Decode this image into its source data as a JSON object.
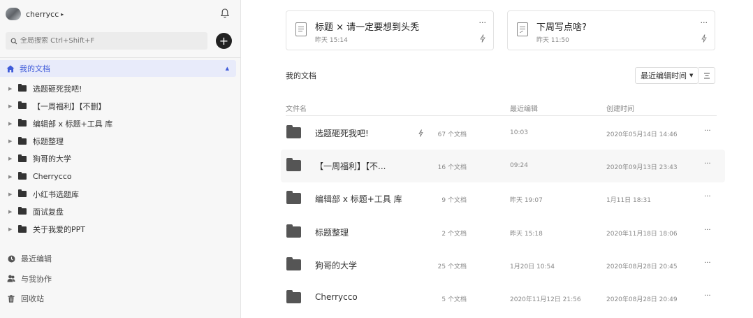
{
  "user": {
    "name": "cherrycc",
    "caret": "▸"
  },
  "search": {
    "placeholder": "全局搜索 Ctrl+Shift+F"
  },
  "add_label": "+",
  "my_docs": {
    "label": "我的文档",
    "caret": "▲"
  },
  "tree": {
    "arrow": "▶",
    "items": [
      {
        "label": "选题砸死我吧!"
      },
      {
        "label": "【一周福利】【不删】"
      },
      {
        "label": "编辑部 x 标题+工具 库"
      },
      {
        "label": "标题整理"
      },
      {
        "label": "狗哥的大学"
      },
      {
        "label": "Cherrycco"
      },
      {
        "label": "小红书选题库"
      },
      {
        "label": "面试复盘"
      },
      {
        "label": "关于我爱的PPT"
      }
    ]
  },
  "bottom_nav": [
    {
      "label": "最近编辑",
      "icon": "clock-icon"
    },
    {
      "label": "与我协作",
      "icon": "people-icon"
    },
    {
      "label": "回收站",
      "icon": "trash-icon"
    }
  ],
  "recent_cards": [
    {
      "title": "标题 × 请一定要想到头秃",
      "time": "昨天 15:14",
      "more": "···"
    },
    {
      "title": "下周写点啥?",
      "time": "昨天 11:50",
      "more": "···"
    }
  ],
  "section_title": "我的文档",
  "sort": {
    "label": "最近编辑时间",
    "caret": "▼"
  },
  "table": {
    "headers": {
      "name": "文件名",
      "edited": "最近编辑",
      "created": "创建时间"
    },
    "rows": [
      {
        "name": "选题砸死我吧!",
        "count": "67 个文档",
        "edited": "10:03",
        "created": "2020年05月14日 14:46",
        "bolt": true
      },
      {
        "name": "【一周福利】【不...",
        "count": "16 个文档",
        "edited": "09:24",
        "created": "2020年09月13日 23:43",
        "bolt": false
      },
      {
        "name": "编辑部 x 标题+工具 库",
        "count": "9 个文档",
        "edited": "昨天 19:07",
        "created": "1月11日 18:31",
        "bolt": false
      },
      {
        "name": "标题整理",
        "count": "2 个文档",
        "edited": "昨天 15:18",
        "created": "2020年11月18日 18:06",
        "bolt": false
      },
      {
        "name": "狗哥的大学",
        "count": "25 个文档",
        "edited": "1月20日 10:54",
        "created": "2020年08月28日 20:45",
        "bolt": false
      },
      {
        "name": "Cherrycco",
        "count": "5 个文档",
        "edited": "2020年11月12日 21:56",
        "created": "2020年08月28日 20:49",
        "bolt": false
      }
    ],
    "more": "···"
  },
  "colors": {
    "accent": "#3f5bd9",
    "active_bg": "#e8ebfa",
    "sidebar_bg": "#f7f7f7"
  }
}
